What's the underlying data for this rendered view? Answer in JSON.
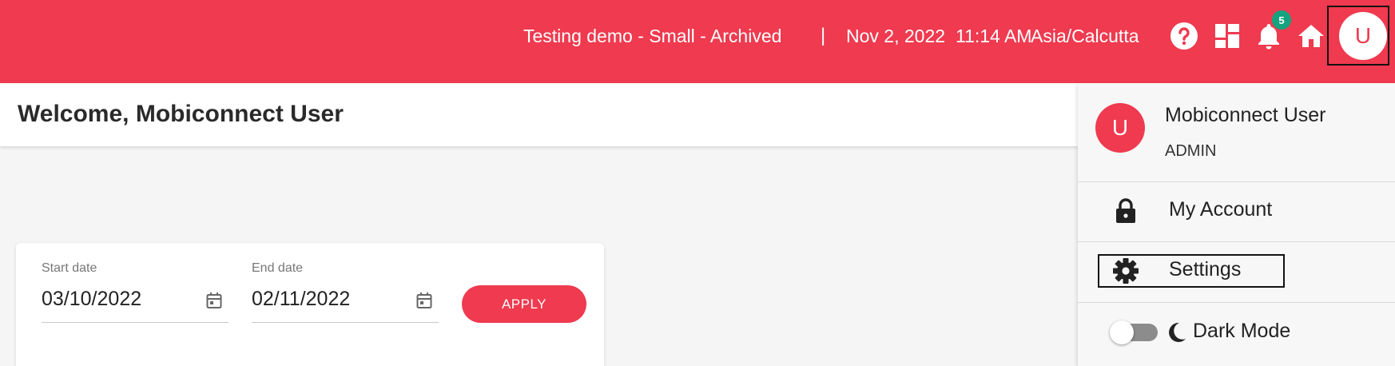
{
  "header": {
    "org_title": "Testing demo - Small - Archived",
    "separator": "|",
    "date": "Nov 2, 2022",
    "time": "11:14 AM",
    "timezone": "Asia/Calcutta",
    "notification_count": "5",
    "avatar_initial": "U",
    "icons": [
      "help-icon",
      "dashboard-icon",
      "bell-icon",
      "home-icon"
    ]
  },
  "page": {
    "welcome_text": "Welcome, Mobiconnect User"
  },
  "filters": {
    "start_label": "Start date",
    "start_value": "03/10/2022",
    "end_label": "End date",
    "end_value": "02/11/2022",
    "apply_label": "APPLY"
  },
  "user_menu": {
    "avatar_initial": "U",
    "user_name": "Mobiconnect User",
    "role": "ADMIN",
    "items": [
      {
        "label": "My Account",
        "icon": "lock-icon"
      },
      {
        "label": "Settings",
        "icon": "gear-icon"
      }
    ],
    "dark_mode_label": "Dark Mode",
    "dark_mode_on": false
  },
  "colors": {
    "brand": "#ef3a4f",
    "badge": "#14a37f"
  }
}
